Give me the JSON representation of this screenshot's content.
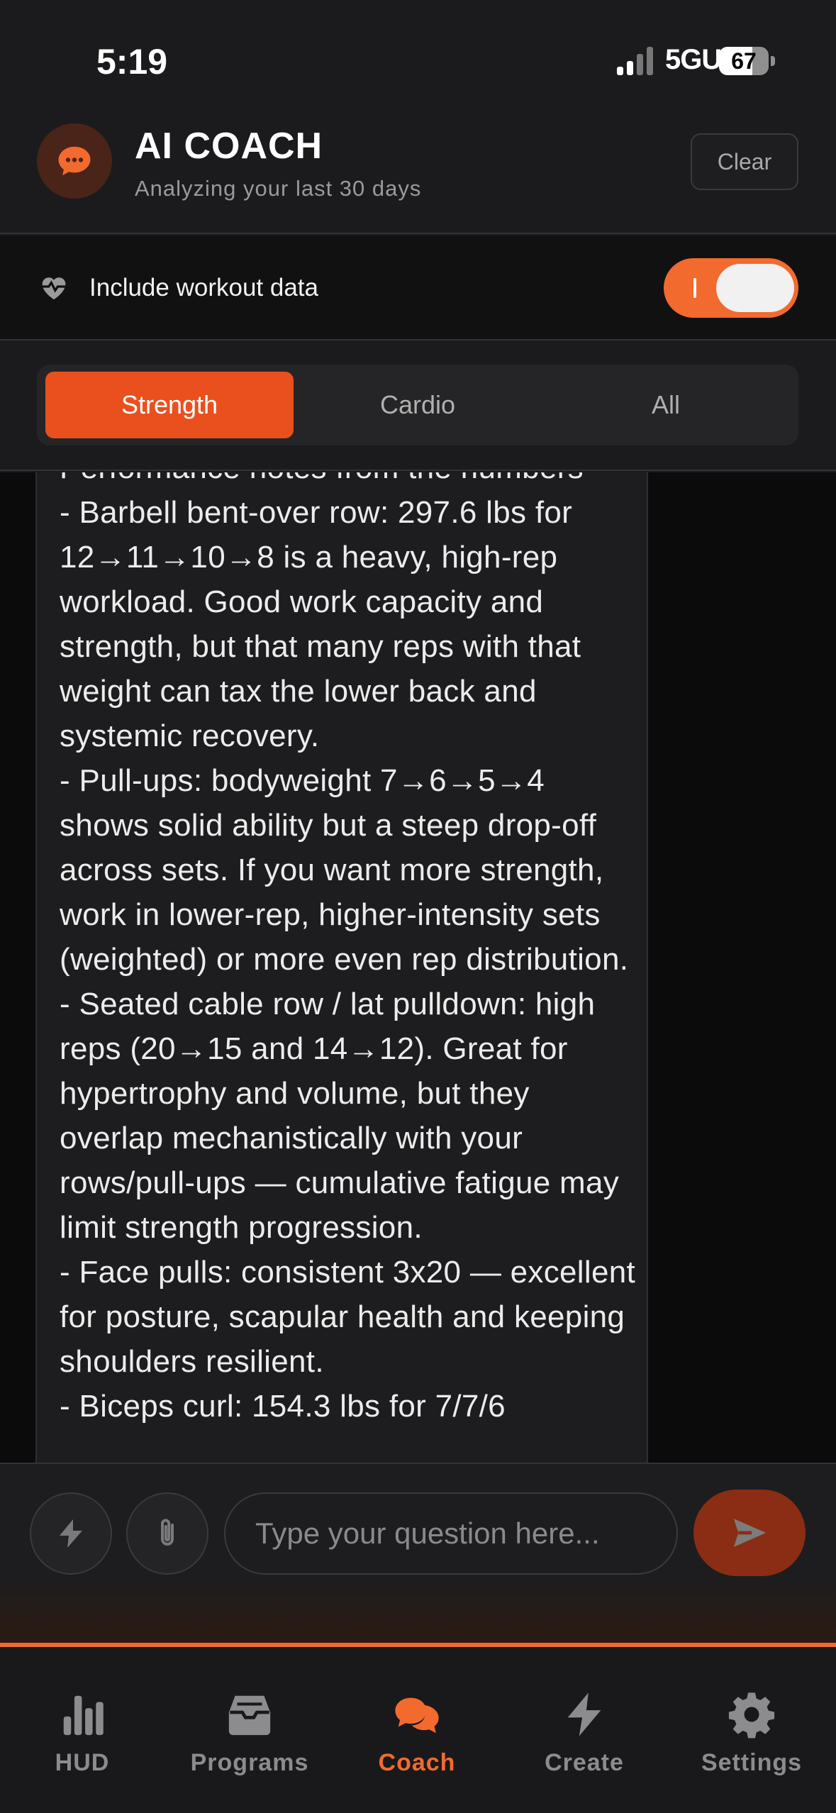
{
  "status_bar": {
    "time": "5:19",
    "network": "5GUC",
    "battery": "67",
    "battery_level": 0.67
  },
  "header": {
    "title": "AI COACH",
    "subtitle": "Analyzing your last 30 days",
    "clear_label": "Clear"
  },
  "toggle": {
    "label": "Include workout data",
    "on": true
  },
  "tabs": [
    {
      "label": "Strength",
      "active": true
    },
    {
      "label": "Cardio",
      "active": false
    },
    {
      "label": "All",
      "active": false
    }
  ],
  "message": {
    "text": "Performance notes from the numbers\n- Barbell bent-over row: 297.6 lbs for 12→11→10→8 is a heavy, high-rep workload. Good work capacity and strength, but that many reps with that weight can tax the lower back and systemic recovery.\n- Pull-ups: bodyweight 7→6→5→4 shows solid ability but a steep drop-off across sets. If you want more strength, work in lower-rep, higher-intensity sets (weighted) or more even rep distribution.\n- Seated cable row / lat pulldown: high reps (20→15 and 14→12). Great for hypertrophy and volume, but they overlap mechanistically with your rows/pull-ups — cumulative fatigue may limit strength progression.\n- Face pulls: consistent 3x20 — excellent for posture, scapular health and keeping shoulders resilient.\n- Biceps curl: 154.3 lbs for 7/7/6"
  },
  "composer": {
    "placeholder": "Type your question here..."
  },
  "colors": {
    "accent": "#f26a2e",
    "tab_active": "#e9501e",
    "send": "#8a2d14"
  },
  "nav": [
    {
      "label": "HUD",
      "icon": "bar-chart-icon",
      "active": false
    },
    {
      "label": "Programs",
      "icon": "archive-box-icon",
      "active": false
    },
    {
      "label": "Coach",
      "icon": "chat-bubbles-icon",
      "active": true
    },
    {
      "label": "Create",
      "icon": "bolt-icon",
      "active": false
    },
    {
      "label": "Settings",
      "icon": "gear-icon",
      "active": false
    }
  ]
}
